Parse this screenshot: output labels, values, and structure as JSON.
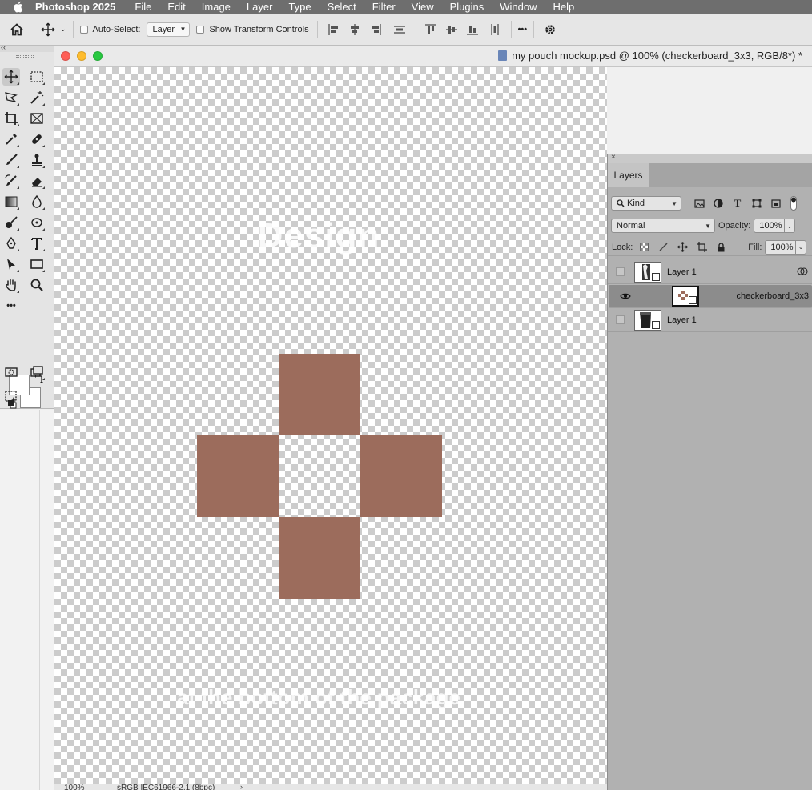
{
  "menubar": {
    "app": "Photoshop 2025",
    "items": [
      "File",
      "Edit",
      "Image",
      "Layer",
      "Type",
      "Select",
      "Filter",
      "View",
      "Plugins",
      "Window",
      "Help"
    ]
  },
  "options": {
    "auto_select_label": "Auto-Select:",
    "auto_select_value": "Layer",
    "show_transform_label": "Show Transform Controls",
    "more": "•••"
  },
  "tools": {
    "collapse_glyph": "‹‹",
    "more_tools": "•••"
  },
  "document": {
    "title": "my pouch mockup.psd @ 100% (checkerboard_3x3, RGB/8*) *",
    "design_text": "Design",
    "bottom_text": "at the bottom of the package"
  },
  "status": {
    "zoom": "100%",
    "profile": "sRGB IEC61966-2.1 (8bpc)",
    "arrow": "›"
  },
  "layers_panel": {
    "close": "×",
    "tab": "Layers",
    "filter_kind": "Kind",
    "blend_mode": "Normal",
    "opacity_label": "Opacity:",
    "opacity_value": "100%",
    "lock_label": "Lock:",
    "fill_label": "Fill:",
    "fill_value": "100%",
    "layers": [
      {
        "name": "Layer 1",
        "visible": false,
        "selected": false
      },
      {
        "name": "checkerboard_3x3",
        "visible": true,
        "selected": true
      },
      {
        "name": "Layer 1",
        "visible": false,
        "selected": false
      }
    ]
  },
  "colors": {
    "shape": "#9c6c5c",
    "menubar": "#6e6e6e",
    "layers_bg": "#b1b1b1",
    "selected_layer": "#8c8c8c"
  }
}
